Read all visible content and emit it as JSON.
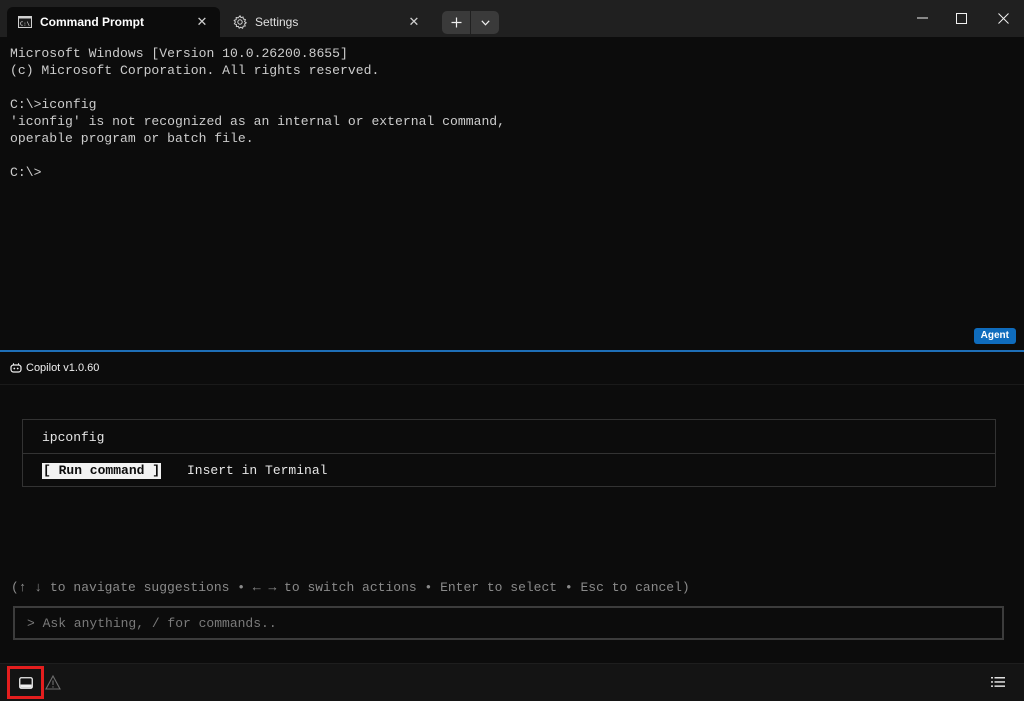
{
  "tabs": [
    {
      "label": "Command Prompt",
      "icon": "cmd-icon",
      "active": true
    },
    {
      "label": "Settings",
      "icon": "gear-icon",
      "active": false
    }
  ],
  "terminal": {
    "lines": [
      "Microsoft Windows [Version 10.0.26200.8655]",
      "(c) Microsoft Corporation. All rights reserved.",
      "",
      "C:\\>iconfig",
      "'iconfig' is not recognized as an internal or external command,",
      "operable program or batch file.",
      "",
      "C:\\>"
    ],
    "agent_badge": "Agent"
  },
  "copilot": {
    "title": "Copilot v1.0.60",
    "suggestion": "ipconfig",
    "actions": {
      "run": "[ Run command ]",
      "insert": "Insert in Terminal"
    },
    "hint": "(↑ ↓ to navigate suggestions • ← → to switch actions • Enter to select • Esc to cancel)",
    "input_placeholder": "> Ask anything, / for commands.."
  },
  "colors": {
    "accent": "#0f6cbd",
    "highlight_box": "#e41e1e",
    "background": "#0c0c0c"
  }
}
